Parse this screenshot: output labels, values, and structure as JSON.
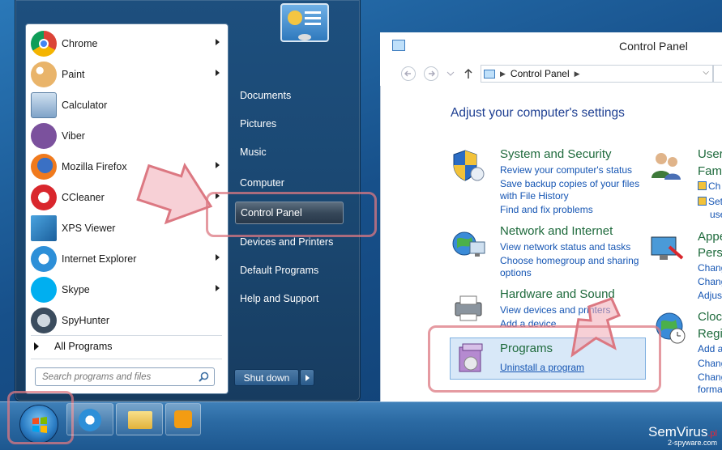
{
  "start_menu": {
    "programs": [
      {
        "label": "Chrome",
        "has_arrow": true,
        "icon": "chrome-icon"
      },
      {
        "label": "Paint",
        "has_arrow": true,
        "icon": "paint-icon"
      },
      {
        "label": "Calculator",
        "has_arrow": false,
        "icon": "calculator-icon"
      },
      {
        "label": "Viber",
        "has_arrow": false,
        "icon": "viber-icon"
      },
      {
        "label": "Mozilla Firefox",
        "has_arrow": true,
        "icon": "firefox-icon"
      },
      {
        "label": "CCleaner",
        "has_arrow": true,
        "icon": "ccleaner-icon"
      },
      {
        "label": "XPS Viewer",
        "has_arrow": false,
        "icon": "xps-viewer-icon"
      },
      {
        "label": "Internet Explorer",
        "has_arrow": true,
        "icon": "internet-explorer-icon"
      },
      {
        "label": "Skype",
        "has_arrow": true,
        "icon": "skype-icon"
      },
      {
        "label": "SpyHunter",
        "has_arrow": false,
        "icon": "spyhunter-icon"
      }
    ],
    "all_programs": "All Programs",
    "search_placeholder": "Search programs and files",
    "right_items": [
      {
        "label": "Documents"
      },
      {
        "label": "Pictures"
      },
      {
        "label": "Music"
      },
      {
        "label": "Computer"
      },
      {
        "label": "Control Panel",
        "highlighted": true
      },
      {
        "label": "Devices and Printers"
      },
      {
        "label": "Default Programs"
      },
      {
        "label": "Help and Support"
      }
    ],
    "shutdown_label": "Shut down"
  },
  "control_panel": {
    "window_title": "Control Panel",
    "address": "Control Panel",
    "heading": "Adjust your computer's settings",
    "categories": [
      {
        "title": "System and Security",
        "links": [
          "Review your computer's status",
          "Save backup copies of your files",
          "with File History",
          "Find and fix problems"
        ]
      },
      {
        "title": "Network and Internet",
        "links": [
          "View network status and tasks",
          "Choose homegroup and sharing",
          "options"
        ]
      },
      {
        "title": "Hardware and Sound",
        "links": [
          "View devices and printers",
          "Add a device"
        ]
      },
      {
        "title": "Programs",
        "links": [
          "Uninstall a program"
        ]
      }
    ],
    "right_column": [
      {
        "title": "User",
        "sub": "Fam",
        "links": [
          "Ch",
          "Set",
          "use"
        ]
      },
      {
        "title": "Appe",
        "sub": "Pers",
        "links": [
          "Chang",
          "Chang",
          "Adjus"
        ]
      },
      {
        "title": "Clock",
        "sub": "Regi",
        "links": [
          "Add a",
          "Chang",
          "Chang",
          "forma"
        ]
      }
    ]
  },
  "watermark": {
    "brand": "SemVirus",
    "suffix": ".pl",
    "sub": "2-spyware.com"
  },
  "colors": {
    "highlight": "#dc7882",
    "link": "#1555b3",
    "category": "#1e6a3c",
    "heading": "#1e3f92"
  }
}
